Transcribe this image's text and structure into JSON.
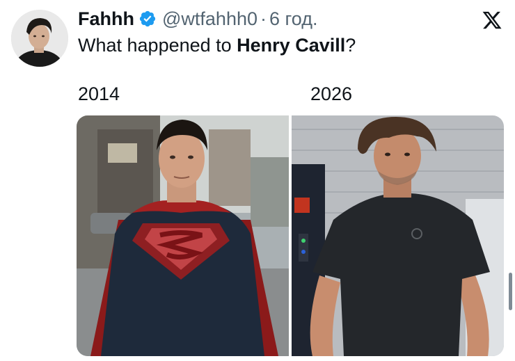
{
  "author": {
    "name": "Fahhh",
    "handle": "@wtfahhh0",
    "separator": "·",
    "time": "6 год."
  },
  "tweet": {
    "text_prefix": "What happened to ",
    "text_bold": "Henry Cavill",
    "text_suffix": "?"
  },
  "media": {
    "left_label": "2014",
    "right_label": "2026"
  },
  "icons": {
    "verified": "verified-badge-icon",
    "brand": "x-logo-icon"
  },
  "colors": {
    "verified_blue": "#1d9bf0",
    "text_primary": "#0f1419",
    "text_secondary": "#536471"
  }
}
